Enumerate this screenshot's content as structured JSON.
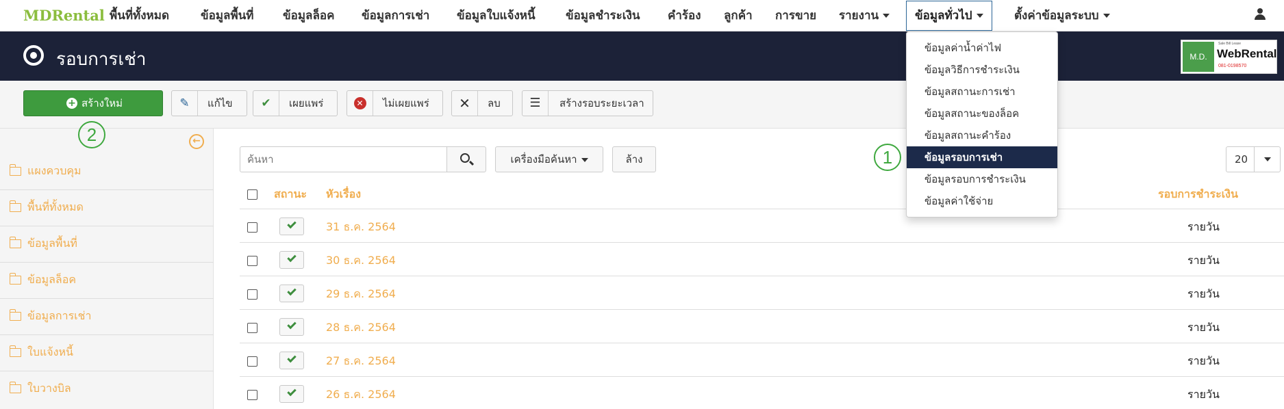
{
  "navbar": {
    "brand": "MDRental",
    "items": [
      {
        "label": "พื้นที่ทั้งหมด"
      },
      {
        "label": "ข้อมูลพื้นที่"
      },
      {
        "label": "ข้อมูลล็อค"
      },
      {
        "label": "ข้อมูลการเช่า"
      },
      {
        "label": "ข้อมูลใบแจ้งหนี้"
      },
      {
        "label": "ข้อมูลชำระเงิน"
      },
      {
        "label": "คำร้อง"
      },
      {
        "label": "ลูกค้า"
      },
      {
        "label": "การขาย"
      },
      {
        "label": "รายงาน"
      },
      {
        "label": "ข้อมูลทั่วไป"
      },
      {
        "label": "ตั้งค่าข้อมูลระบบ"
      }
    ],
    "user_icon": "user-icon"
  },
  "titlebar": {
    "title": "รอบการเช่า",
    "icon": "target-icon",
    "logo": {
      "prefix": "M.D.",
      "name": "WebRental",
      "phone": "081-0198570",
      "tag": "Sale Bill Lease"
    }
  },
  "toolbar": {
    "new_label": "สร้างใหม่",
    "edit_label": "แก้ไข",
    "publish_label": "เผยแพร่",
    "unpublish_label": "ไม่เผยแพร่",
    "delete_label": "ลบ",
    "create_period_label": "สร้างรอบระยะเวลา"
  },
  "sidebar": {
    "items": [
      {
        "label": "แผงควบคุม"
      },
      {
        "label": "พื้นที่ทั้งหมด"
      },
      {
        "label": "ข้อมูลพื้นที่"
      },
      {
        "label": "ข้อมูลล็อค"
      },
      {
        "label": "ข้อมูลการเช่า"
      },
      {
        "label": "ใบแจ้งหนี้"
      },
      {
        "label": "ใบวางบิล"
      }
    ]
  },
  "search": {
    "placeholder": "ค้นหา",
    "tools_label": "เครื่องมือค้นหา",
    "clear_label": "ล้าง",
    "limit": "20"
  },
  "table": {
    "headers": {
      "status": "สถานะ",
      "title": "หัวเรื่อง",
      "cycle": "รอบการชำระเงิน"
    },
    "rows": [
      {
        "title": "31 ธ.ค. 2564",
        "cycle": "รายวัน"
      },
      {
        "title": "30 ธ.ค. 2564",
        "cycle": "รายวัน"
      },
      {
        "title": "29 ธ.ค. 2564",
        "cycle": "รายวัน"
      },
      {
        "title": "28 ธ.ค. 2564",
        "cycle": "รายวัน"
      },
      {
        "title": "27 ธ.ค. 2564",
        "cycle": "รายวัน"
      },
      {
        "title": "26 ธ.ค. 2564",
        "cycle": "รายวัน"
      }
    ]
  },
  "dropdown": {
    "items": [
      {
        "label": "ข้อมูลค่าน้ำค่าไฟ"
      },
      {
        "label": "ข้อมูลวิธีการชำระเงิน"
      },
      {
        "label": "ข้อมูลสถานะการเช่า"
      },
      {
        "label": "ข้อมูลสถานะของล็อค"
      },
      {
        "label": "ข้อมูลสถานะคำร้อง"
      },
      {
        "label": "ข้อมูลรอบการเช่า"
      },
      {
        "label": "ข้อมูลรอบการชำระเงิน"
      },
      {
        "label": "ข้อมูลค่าใช้จ่าย"
      }
    ]
  },
  "annotations": {
    "one": "1",
    "two": "2"
  },
  "colors": {
    "accent": "#f0ad4e",
    "nav_dark": "#1c2238",
    "success": "#3e9b3e",
    "annotation": "#3ea83e"
  }
}
